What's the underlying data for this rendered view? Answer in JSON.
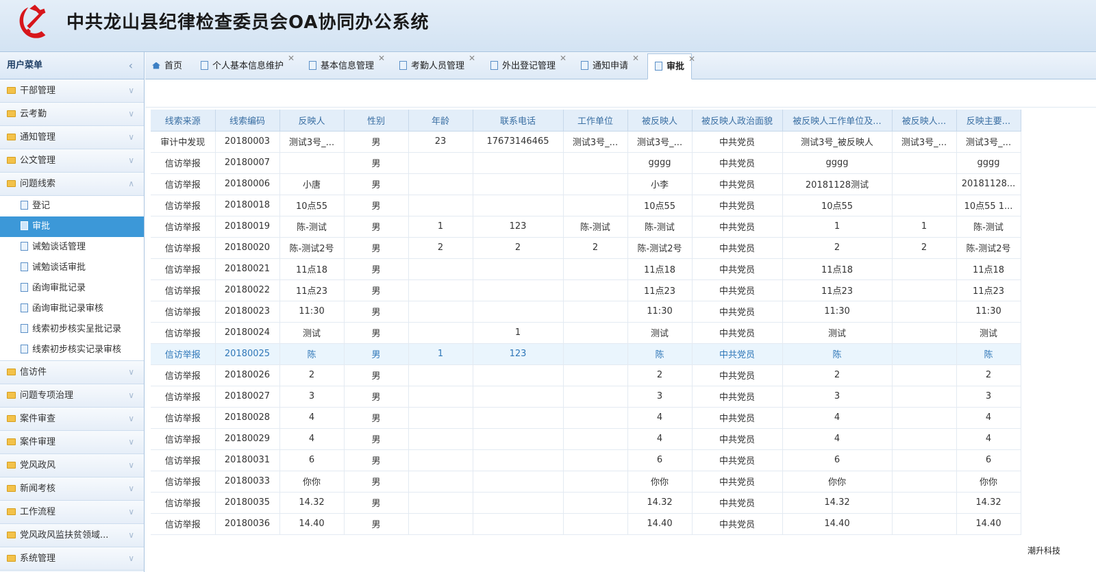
{
  "app": {
    "title": "中共龙山县纪律检查委员会OA协同办公系统",
    "brand": "潮升科技"
  },
  "sidebar": {
    "title": "用户菜单",
    "groups_top": [
      {
        "label": "干部管理"
      },
      {
        "label": "云考勤"
      },
      {
        "label": "通知管理"
      },
      {
        "label": "公文管理"
      }
    ],
    "open_group": {
      "label": "问题线索",
      "items": [
        {
          "label": "登记"
        },
        {
          "label": "审批"
        },
        {
          "label": "诫勉谈话管理"
        },
        {
          "label": "诫勉谈话审批"
        },
        {
          "label": "函询审批记录"
        },
        {
          "label": "函询审批记录审核"
        },
        {
          "label": "线索初步核实呈批记录"
        },
        {
          "label": "线索初步核实记录审核"
        }
      ]
    },
    "groups_bottom": [
      {
        "label": "信访件"
      },
      {
        "label": "问题专项治理"
      },
      {
        "label": "案件审查"
      },
      {
        "label": "案件审理"
      },
      {
        "label": "党风政风"
      },
      {
        "label": "新闻考核"
      },
      {
        "label": "工作流程"
      },
      {
        "label": "党风政风监扶贫领域..."
      },
      {
        "label": "系统管理"
      }
    ]
  },
  "tabs": [
    {
      "label": "首页"
    },
    {
      "label": "个人基本信息维护"
    },
    {
      "label": "基本信息管理"
    },
    {
      "label": "考勤人员管理"
    },
    {
      "label": "外出登记管理"
    },
    {
      "label": "通知申请"
    },
    {
      "label": "审批"
    }
  ],
  "table": {
    "headers": [
      "线索来源",
      "线索编码",
      "反映人",
      "性别",
      "年龄",
      "联系电话",
      "工作单位",
      "被反映人",
      "被反映人政治面貌",
      "被反映人工作单位及...",
      "被反映人...",
      "反映主要..."
    ],
    "rows": [
      [
        "审计中发现",
        "20180003",
        "测试3号_...",
        "男",
        "23",
        "17673146465",
        "测试3号_...",
        "测试3号_...",
        "中共党员",
        "测试3号_被反映人",
        "测试3号_...",
        "测试3号_..."
      ],
      [
        "信访举报",
        "20180007",
        "",
        "男",
        "",
        "",
        "",
        "gggg",
        "中共党员",
        "gggg",
        "",
        "gggg"
      ],
      [
        "信访举报",
        "20180006",
        "小唐",
        "男",
        "",
        "",
        "",
        "小李",
        "中共党员",
        "20181128测试",
        "",
        "20181128..."
      ],
      [
        "信访举报",
        "20180018",
        "10点55",
        "男",
        "",
        "",
        "",
        "10点55",
        "中共党员",
        "10点55",
        "",
        "10点55 1..."
      ],
      [
        "信访举报",
        "20180019",
        "陈-测试",
        "男",
        "1",
        "123",
        "陈-测试",
        "陈-测试",
        "中共党员",
        "1",
        "1",
        "陈-测试"
      ],
      [
        "信访举报",
        "20180020",
        "陈-测试2号",
        "男",
        "2",
        "2",
        "2",
        "陈-测试2号",
        "中共党员",
        "2",
        "2",
        "陈-测试2号"
      ],
      [
        "信访举报",
        "20180021",
        "11点18",
        "男",
        "",
        "",
        "",
        "11点18",
        "中共党员",
        "11点18",
        "",
        "11点18"
      ],
      [
        "信访举报",
        "20180022",
        "11点23",
        "男",
        "",
        "",
        "",
        "11点23",
        "中共党员",
        "11点23",
        "",
        "11点23"
      ],
      [
        "信访举报",
        "20180023",
        "11:30",
        "男",
        "",
        "",
        "",
        "11:30",
        "中共党员",
        "11:30",
        "",
        "11:30"
      ],
      [
        "信访举报",
        "20180024",
        "测试",
        "男",
        "",
        "1",
        "",
        "测试",
        "中共党员",
        "测试",
        "",
        "测试"
      ],
      [
        "信访举报",
        "20180025",
        "陈",
        "男",
        "1",
        "123",
        "",
        "陈",
        "中共党员",
        "陈",
        "",
        "陈"
      ],
      [
        "信访举报",
        "20180026",
        "2",
        "男",
        "",
        "",
        "",
        "2",
        "中共党员",
        "2",
        "",
        "2"
      ],
      [
        "信访举报",
        "20180027",
        "3",
        "男",
        "",
        "",
        "",
        "3",
        "中共党员",
        "3",
        "",
        "3"
      ],
      [
        "信访举报",
        "20180028",
        "4",
        "男",
        "",
        "",
        "",
        "4",
        "中共党员",
        "4",
        "",
        "4"
      ],
      [
        "信访举报",
        "20180029",
        "4",
        "男",
        "",
        "",
        "",
        "4",
        "中共党员",
        "4",
        "",
        "4"
      ],
      [
        "信访举报",
        "20180031",
        "6",
        "男",
        "",
        "",
        "",
        "6",
        "中共党员",
        "6",
        "",
        "6"
      ],
      [
        "信访举报",
        "20180033",
        "你你",
        "男",
        "",
        "",
        "",
        "你你",
        "中共党员",
        "你你",
        "",
        "你你"
      ],
      [
        "信访举报",
        "20180035",
        "14.32",
        "男",
        "",
        "",
        "",
        "14.32",
        "中共党员",
        "14.32",
        "",
        "14.32"
      ],
      [
        "信访举报",
        "20180036",
        "14.40",
        "男",
        "",
        "",
        "",
        "14.40",
        "中共党员",
        "14.40",
        "",
        "14.40"
      ]
    ]
  }
}
